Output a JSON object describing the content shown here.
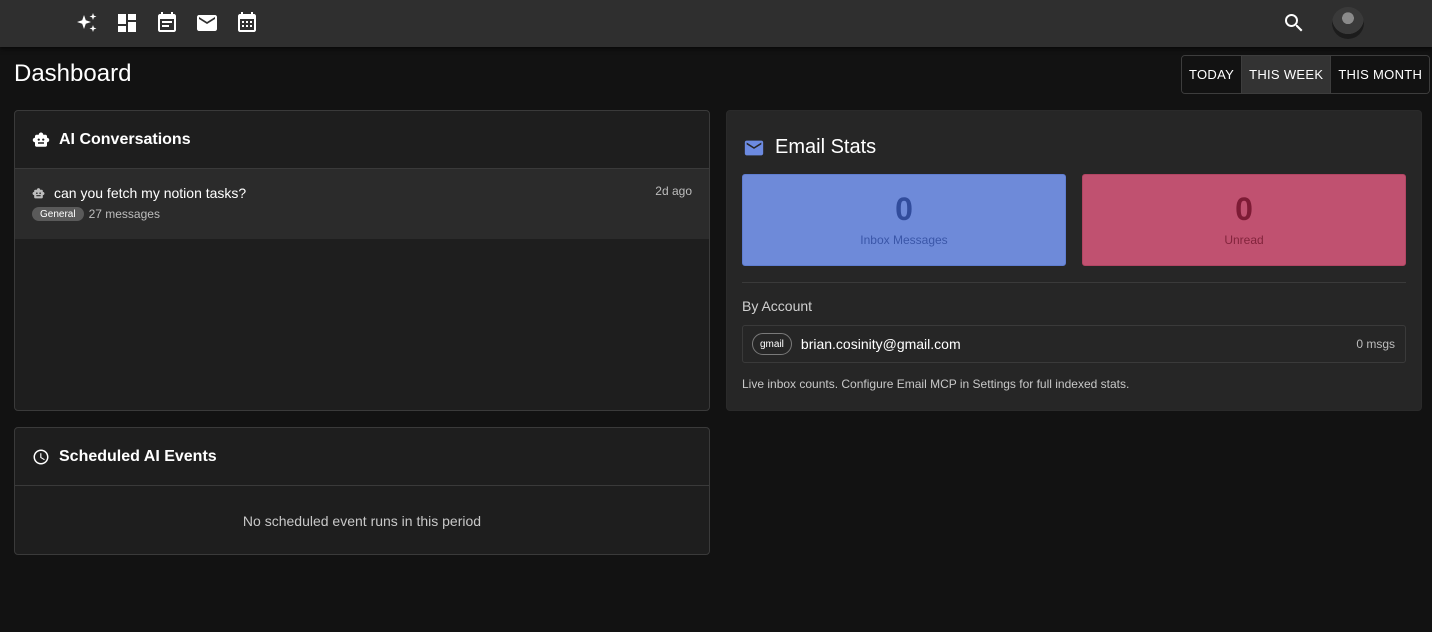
{
  "appbar": {
    "nav_icons": [
      "sparkles-icon",
      "dashboard-icon",
      "event-note-icon",
      "mail-icon",
      "calendar-icon"
    ],
    "search_icon": "search-icon"
  },
  "page": {
    "title": "Dashboard"
  },
  "range": {
    "options": [
      {
        "label": "TODAY",
        "active": false
      },
      {
        "label": "THIS WEEK",
        "active": true
      },
      {
        "label": "THIS MONTH",
        "active": false
      }
    ]
  },
  "conversations": {
    "title": "AI Conversations",
    "items": [
      {
        "title": "can you fetch my notion tasks?",
        "time": "2d ago",
        "tag": "General",
        "count": "27 messages"
      }
    ]
  },
  "scheduled": {
    "title": "Scheduled AI Events",
    "empty": "No scheduled event runs in this period"
  },
  "email": {
    "title": "Email Stats",
    "inbox": {
      "value": "0",
      "label": "Inbox Messages"
    },
    "unread": {
      "value": "0",
      "label": "Unread"
    },
    "by_account_label": "By Account",
    "accounts": [
      {
        "provider": "gmail",
        "email": "brian.cosinity@gmail.com",
        "count": "0 msgs"
      }
    ],
    "note": "Live inbox counts. Configure Email MCP in Settings for full indexed stats."
  },
  "colors": {
    "inbox_box": "#6e8ad9",
    "unread_box": "#c05170",
    "mail_accent": "#6c8ae0"
  }
}
